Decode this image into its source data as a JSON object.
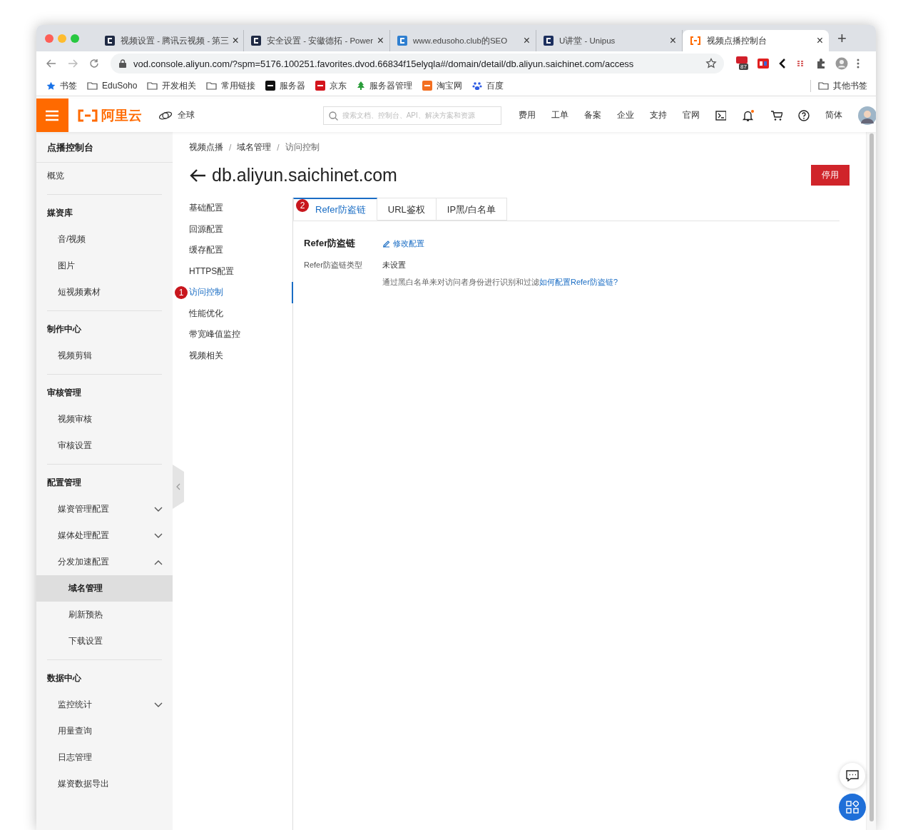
{
  "browser": {
    "tabs": [
      {
        "title": "视频设置 - 腾讯云视频 - 第三",
        "kind": "dark-tile",
        "selected": false,
        "close": "×"
      },
      {
        "title": "安全设置 - 安徽德拓 - Power",
        "kind": "dark-tile",
        "selected": false,
        "close": "×"
      },
      {
        "title": "www.edusoho.club的SEO",
        "kind": "color-tile",
        "selected": false,
        "close": "×"
      },
      {
        "title": "U讲堂 - Unipus",
        "kind": "navy-tile",
        "selected": false,
        "close": "×"
      },
      {
        "title": "视频点播控制台",
        "kind": "bracket",
        "selected": true,
        "close": "×"
      }
    ],
    "new_tab": "+",
    "url": "vod.console.aliyun.com/?spm=5176.100251.favorites.dvod.66834f15elyqla#/domain/detail/db.aliyun.saichinet.com/access",
    "extension_badge": "87",
    "bookmarks": [
      {
        "label": "书签",
        "kind": "star"
      },
      {
        "label": "EduSoho",
        "kind": "folder"
      },
      {
        "label": "开发相关",
        "kind": "folder"
      },
      {
        "label": "常用链接",
        "kind": "folder"
      },
      {
        "label": "服务器",
        "kind": "black-tile"
      },
      {
        "label": "京东",
        "kind": "red-tile"
      },
      {
        "label": "服务器管理",
        "kind": "tree"
      },
      {
        "label": "淘宝网",
        "kind": "orange-tile"
      },
      {
        "label": "百度",
        "kind": "paw"
      }
    ],
    "other_bookmarks": "其他书签"
  },
  "topbar": {
    "logo": "阿里云",
    "region": "全球",
    "search": {
      "placeholder": "搜索文档、控制台、API、解决方案和资源"
    },
    "links": [
      "费用",
      "工单",
      "备案",
      "企业",
      "支持",
      "官网"
    ],
    "language": "简体"
  },
  "sidebar": {
    "title": "点播控制台",
    "sections": [
      {
        "items": [
          {
            "label": "概览",
            "selected": false
          }
        ]
      },
      {
        "heading": "媒资库",
        "items": [
          {
            "label": "音/视频",
            "selected": false
          },
          {
            "label": "图片",
            "selected": false
          },
          {
            "label": "短视频素材",
            "selected": false
          }
        ]
      },
      {
        "heading": "制作中心",
        "items": [
          {
            "label": "视频剪辑",
            "selected": false
          }
        ]
      },
      {
        "heading": "审核管理",
        "items": [
          {
            "label": "视频审核",
            "selected": false
          },
          {
            "label": "审核设置",
            "selected": false
          }
        ]
      },
      {
        "heading": "配置管理",
        "items": [
          {
            "label": "媒资管理配置",
            "selected": false,
            "expanded": false
          },
          {
            "label": "媒体处理配置",
            "selected": false,
            "expanded": false
          },
          {
            "label": "分发加速配置",
            "selected": false,
            "expanded": true,
            "children": [
              {
                "label": "域名管理",
                "selected": true
              },
              {
                "label": "刷新预热",
                "selected": false
              },
              {
                "label": "下载设置",
                "selected": false
              }
            ]
          }
        ]
      },
      {
        "heading": "数据中心",
        "items": [
          {
            "label": "监控统计",
            "selected": false,
            "expanded": false
          },
          {
            "label": "用量查询",
            "selected": false
          },
          {
            "label": "日志管理",
            "selected": false
          },
          {
            "label": "媒资数据导出",
            "selected": false
          }
        ]
      }
    ]
  },
  "breadcrumb": [
    "视频点播",
    "域名管理",
    "访问控制"
  ],
  "breadcrumb_separator": "/",
  "page_title": "db.aliyun.saichinet.com",
  "disable_button": "停用",
  "config_nav": [
    {
      "label": "基础配置",
      "selected": false
    },
    {
      "label": "回源配置",
      "selected": false
    },
    {
      "label": "缓存配置",
      "selected": false
    },
    {
      "label": "HTTPS配置",
      "selected": false
    },
    {
      "label": "访问控制",
      "selected": true,
      "annotation": "1"
    },
    {
      "label": "性能优化",
      "selected": false
    },
    {
      "label": "带宽峰值监控",
      "selected": false
    },
    {
      "label": "视频相关",
      "selected": false
    }
  ],
  "tabs": [
    {
      "label": "Refer防盗链",
      "selected": true,
      "annotation": "2"
    },
    {
      "label": "URL鉴权",
      "selected": false
    },
    {
      "label": "IP黑/白名单",
      "selected": false
    }
  ],
  "section": {
    "title": "Refer防盗链",
    "edit_link": "修改配置",
    "rows": [
      {
        "label": "Refer防盗链类型",
        "value": "未设置",
        "hint": "通过黑白名单来对访问者身份进行识别和过滤",
        "hint_link": "如何配置Refer防盗链?"
      }
    ]
  }
}
